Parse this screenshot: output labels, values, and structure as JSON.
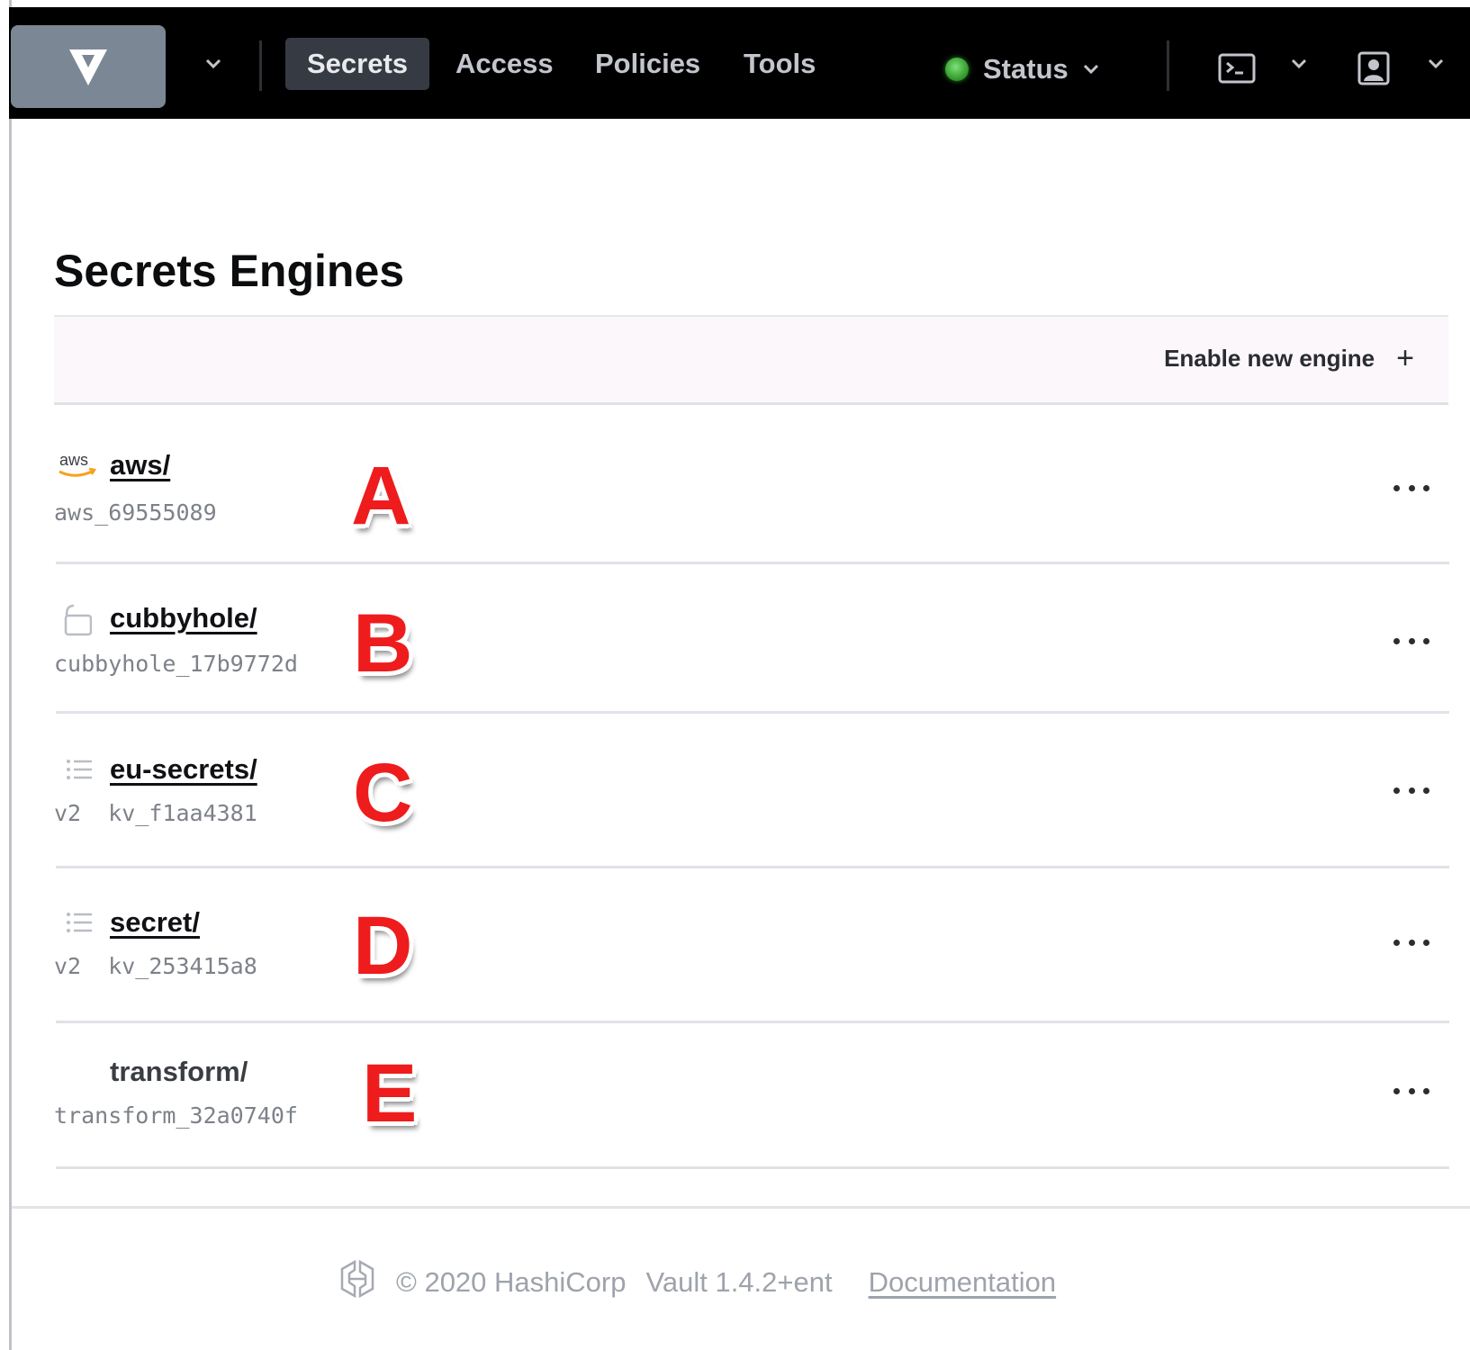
{
  "nav": {
    "logo": "vault-logo",
    "links": [
      {
        "label": "Secrets",
        "active": true
      },
      {
        "label": "Access",
        "active": false
      },
      {
        "label": "Policies",
        "active": false
      },
      {
        "label": "Tools",
        "active": false
      }
    ],
    "status_label": "Status",
    "status_color": "#3ba535",
    "icons": [
      "terminal-icon",
      "user-icon"
    ]
  },
  "main": {
    "title": "Secrets Engines",
    "enable_label": "Enable new engine",
    "engines": [
      {
        "icon": "aws-icon",
        "name": "aws/",
        "sub": "aws_69555089",
        "marker": "A",
        "linked": true
      },
      {
        "icon": "lock-icon",
        "name": "cubbyhole/",
        "sub": "cubbyhole_17b9772d",
        "marker": "B",
        "linked": true
      },
      {
        "icon": "list-icon",
        "name": "eu-secrets/",
        "sub": "v2  kv_f1aa4381",
        "marker": "C",
        "linked": true
      },
      {
        "icon": "list-icon",
        "name": "secret/",
        "sub": "v2  kv_253415a8",
        "marker": "D",
        "linked": true
      },
      {
        "icon": "",
        "name": "transform/",
        "sub": "transform_32a0740f",
        "marker": "E",
        "linked": false
      }
    ]
  },
  "footer": {
    "copyright": "© 2020 HashiCorp",
    "version": "Vault 1.4.2+ent",
    "docs_label": "Documentation"
  },
  "colors": {
    "nav_bg": "#000000",
    "logo_bg": "#7c8796",
    "marker": "#ee1c1c"
  }
}
